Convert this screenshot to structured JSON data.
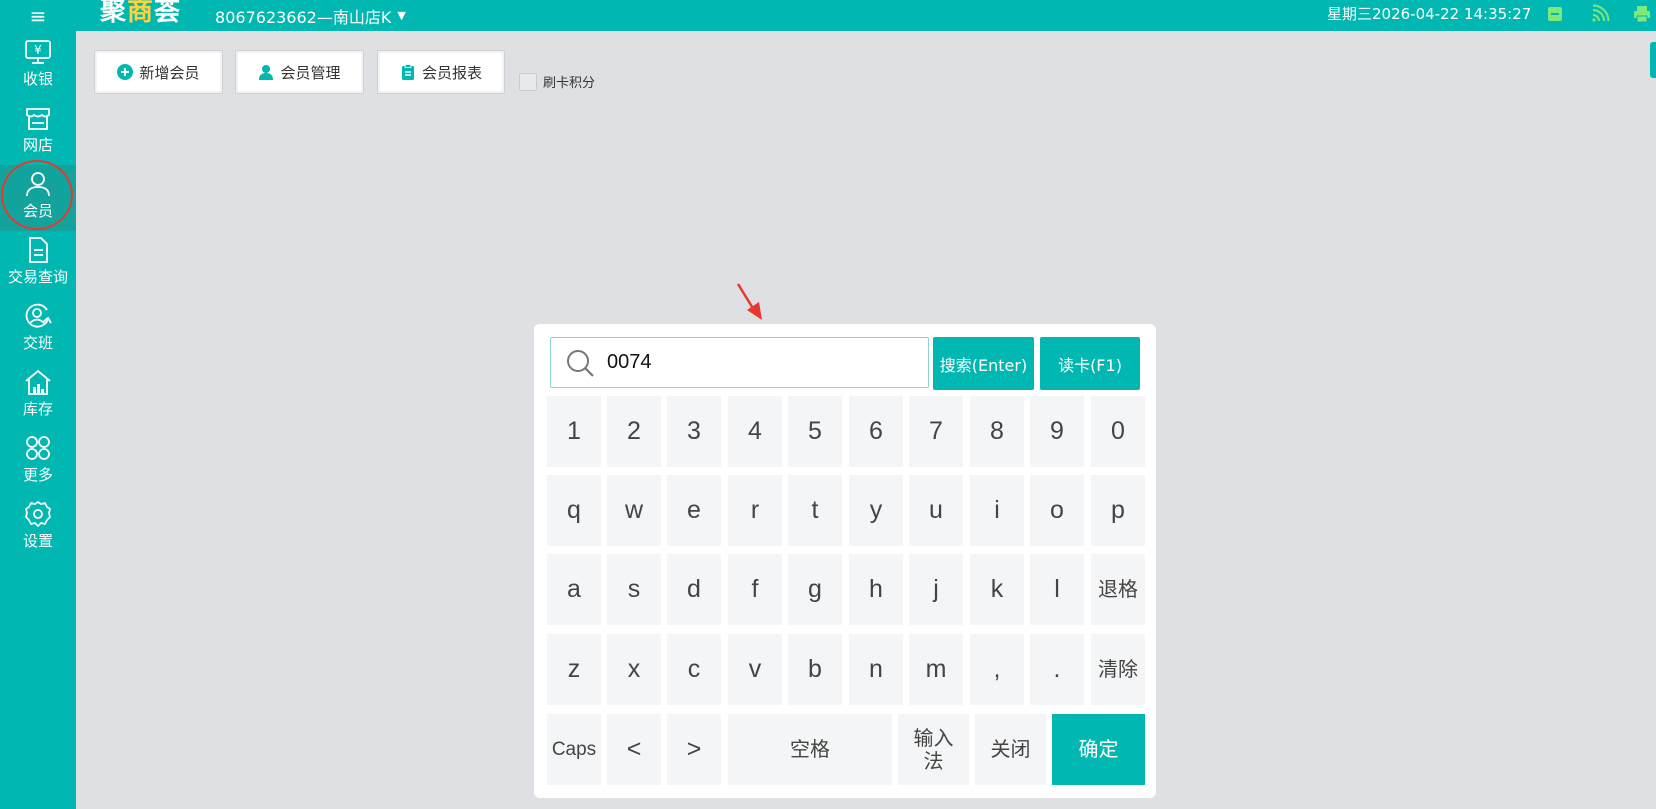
{
  "header": {
    "logo_part1": "聚",
    "logo_part2": "商",
    "logo_part3": "荟",
    "store": "8067623662—南山店K",
    "datetime": "星期三2026-04-22 14:35:27",
    "icons": [
      "menu-icon",
      "cash-drawer-icon",
      "wifi-icon",
      "printer-icon"
    ]
  },
  "sidebar": {
    "items": [
      {
        "label": "收银",
        "icon": "cashier-icon"
      },
      {
        "label": "网店",
        "icon": "shop-icon"
      },
      {
        "label": "会员",
        "icon": "member-icon"
      },
      {
        "label": "交易查询",
        "icon": "transaction-doc-icon"
      },
      {
        "label": "交班",
        "icon": "shift-handover-icon"
      },
      {
        "label": "库存",
        "icon": "inventory-icon"
      },
      {
        "label": "更多",
        "icon": "more-grid-icon"
      },
      {
        "label": "设置",
        "icon": "settings-gear-icon"
      }
    ]
  },
  "toolbar": {
    "add_member": "新增会员",
    "member_manage": "会员管理",
    "member_report": "会员报表",
    "swipe_points": "刷卡积分"
  },
  "keypad": {
    "search_value": "0074",
    "search_button": "搜索(Enter)",
    "read_card_button": "读卡(F1)",
    "row1": [
      "1",
      "2",
      "3",
      "4",
      "5",
      "6",
      "7",
      "8",
      "9",
      "0"
    ],
    "row2": [
      "q",
      "w",
      "e",
      "r",
      "t",
      "y",
      "u",
      "i",
      "o",
      "p"
    ],
    "row3": [
      "a",
      "s",
      "d",
      "f",
      "g",
      "h",
      "j",
      "k",
      "l"
    ],
    "backspace": "退格",
    "row4": [
      "z",
      "x",
      "c",
      "v",
      "b",
      "n",
      "m",
      ",",
      "."
    ],
    "clear": "清除",
    "caps": "Caps",
    "left": "<",
    "right": ">",
    "space": "空格",
    "ime": "输入\n法",
    "close": "关闭",
    "confirm": "确定"
  },
  "colors": {
    "brand": "#00b8b1",
    "highlight_circle": "#e5392f",
    "background": "#dfe0e3"
  }
}
